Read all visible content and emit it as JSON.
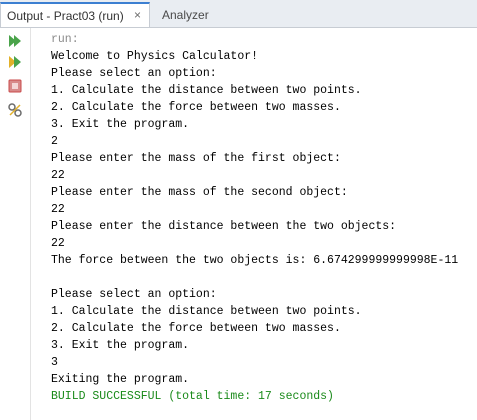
{
  "tabs": [
    {
      "label": "Output - Pract03 (run)",
      "active": true,
      "close": "×"
    },
    {
      "label": "Analyzer",
      "active": false
    }
  ],
  "toolbar": {
    "icons": [
      "rerun-icon",
      "rerun-with-options-icon",
      "stop-icon",
      "settings-icon"
    ],
    "colors": {
      "run": "#4aa34a",
      "stop": "#c94b4b",
      "settings": "#6b6b6b"
    }
  },
  "console": {
    "lines": [
      {
        "text": "run:",
        "style": "muted"
      },
      {
        "text": "Welcome to Physics Calculator!",
        "style": "normal"
      },
      {
        "text": "Please select an option:",
        "style": "normal"
      },
      {
        "text": "1. Calculate the distance between two points.",
        "style": "normal"
      },
      {
        "text": "2. Calculate the force between two masses.",
        "style": "normal"
      },
      {
        "text": "3. Exit the program.",
        "style": "normal"
      },
      {
        "text": "2",
        "style": "normal"
      },
      {
        "text": "Please enter the mass of the first object:",
        "style": "normal"
      },
      {
        "text": "22",
        "style": "normal"
      },
      {
        "text": "Please enter the mass of the second object:",
        "style": "normal"
      },
      {
        "text": "22",
        "style": "normal"
      },
      {
        "text": "Please enter the distance between the two objects:",
        "style": "normal"
      },
      {
        "text": "22",
        "style": "normal"
      },
      {
        "text": "The force between the two objects is: 6.674299999999998E-11",
        "style": "normal"
      },
      {
        "text": "",
        "style": "normal"
      },
      {
        "text": "Please select an option:",
        "style": "normal"
      },
      {
        "text": "1. Calculate the distance between two points.",
        "style": "normal"
      },
      {
        "text": "2. Calculate the force between two masses.",
        "style": "normal"
      },
      {
        "text": "3. Exit the program.",
        "style": "normal"
      },
      {
        "text": "3",
        "style": "normal"
      },
      {
        "text": "Exiting the program.",
        "style": "normal"
      },
      {
        "text": "BUILD SUCCESSFUL (total time: 17 seconds)",
        "style": "success"
      }
    ]
  }
}
